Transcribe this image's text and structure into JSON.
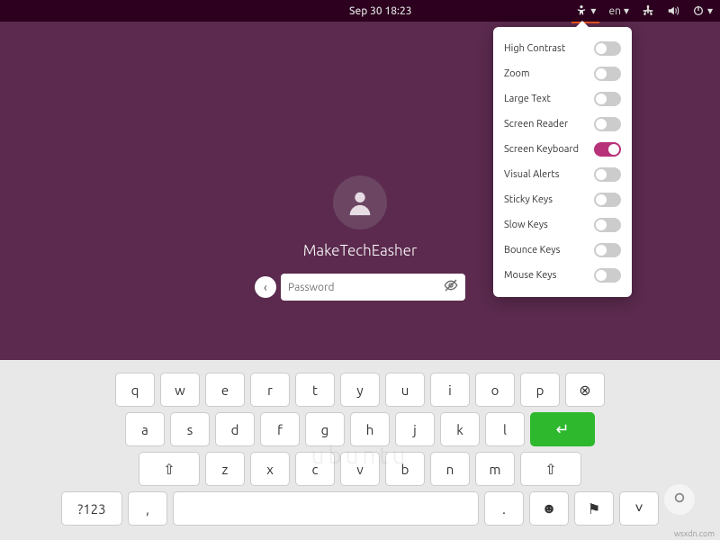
{
  "topbar": {
    "datetime": "Sep 30  18:23",
    "language": "en"
  },
  "a11y": {
    "items": [
      {
        "label": "High Contrast",
        "on": false
      },
      {
        "label": "Zoom",
        "on": false
      },
      {
        "label": "Large Text",
        "on": false
      },
      {
        "label": "Screen Reader",
        "on": false
      },
      {
        "label": "Screen Keyboard",
        "on": true
      },
      {
        "label": "Visual Alerts",
        "on": false
      },
      {
        "label": "Sticky Keys",
        "on": false
      },
      {
        "label": "Slow Keys",
        "on": false
      },
      {
        "label": "Bounce Keys",
        "on": false
      },
      {
        "label": "Mouse Keys",
        "on": false
      }
    ]
  },
  "login": {
    "username": "MakeTechEasher",
    "password_placeholder": "Password"
  },
  "keyboard": {
    "row1": [
      "q",
      "w",
      "e",
      "r",
      "t",
      "y",
      "u",
      "i",
      "o",
      "p"
    ],
    "row2": [
      "a",
      "s",
      "d",
      "f",
      "g",
      "h",
      "j",
      "k",
      "l"
    ],
    "row3": [
      "z",
      "x",
      "c",
      "v",
      "b",
      "n",
      "m"
    ],
    "numkey": "?123",
    "comma": ",",
    "period": "."
  },
  "watermark": "wsxdn.com"
}
